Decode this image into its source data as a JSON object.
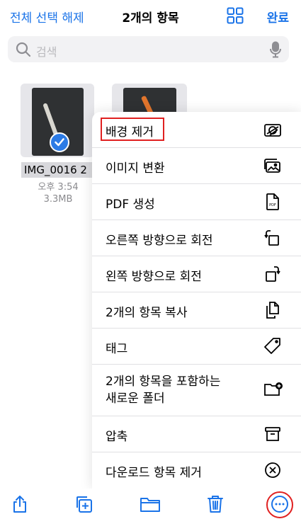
{
  "nav": {
    "deselect_all": "전체 선택 해제",
    "title": "2개의 항목",
    "grid_icon": "grid-icon",
    "done": "완료"
  },
  "search": {
    "placeholder": "검색",
    "icons": [
      "search-icon",
      "mic-icon"
    ]
  },
  "files": [
    {
      "name": "IMG_0016 2",
      "time": "오후 3:54",
      "size": "3.3MB",
      "selected": true
    },
    {
      "name": "",
      "selected": false
    }
  ],
  "menu": {
    "items": [
      {
        "label": "배경 제거",
        "icon": "remove-background-icon",
        "highlighted": true
      },
      {
        "label": "이미지 변환",
        "icon": "convert-image-icon"
      },
      {
        "label": "PDF 생성",
        "icon": "pdf-icon"
      },
      {
        "label": "오른쪽 방향으로 회전",
        "icon": "rotate-right-icon"
      },
      {
        "label": "왼쪽 방향으로 회전",
        "icon": "rotate-left-icon"
      },
      {
        "label": "2개의 항목 복사",
        "icon": "copy-icon"
      },
      {
        "label": "태그",
        "icon": "tag-icon"
      },
      {
        "label": "2개의 항목을 포함하는\n새로운 폴더",
        "icon": "new-folder-icon"
      },
      {
        "label": "압축",
        "icon": "archive-icon"
      },
      {
        "label": "다운로드 항목 제거",
        "icon": "remove-download-icon"
      }
    ]
  },
  "toolbar": {
    "icons": [
      "share-icon",
      "duplicate-icon",
      "folder-icon",
      "trash-icon",
      "more-icon"
    ]
  },
  "colors": {
    "accent": "#1a73e8",
    "highlight": "#e02020",
    "check": "#2c7be5"
  }
}
